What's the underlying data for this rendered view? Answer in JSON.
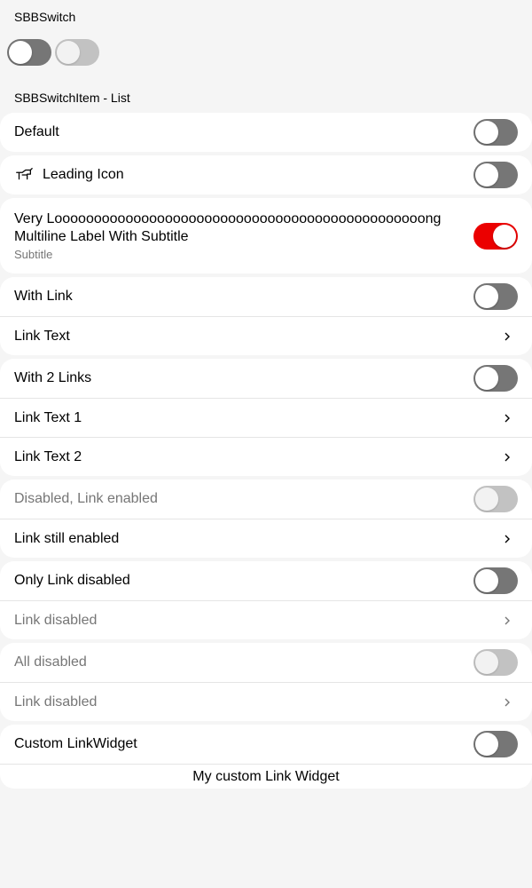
{
  "sbbswitch": {
    "title": "SBBSwitch",
    "switches": [
      {
        "state": "off",
        "enabled": true
      },
      {
        "state": "off",
        "enabled": false
      }
    ]
  },
  "list": {
    "title": "SBBSwitchItem - List",
    "items": {
      "default": {
        "label": "Default",
        "switch": "off"
      },
      "leading_icon": {
        "label": "Leading Icon",
        "icon": "train-icon",
        "switch": "off"
      },
      "multiline": {
        "label_line1": "Very Looooooooooooooooooooooooooooooooooooooooooooooong",
        "label_line2": "Multiline Label With Subtitle",
        "subtitle": "Subtitle",
        "switch": "on"
      },
      "with_link": {
        "label": "With Link",
        "switch": "off",
        "link": "Link Text"
      },
      "with_2_links": {
        "label": "With 2 Links",
        "switch": "off",
        "link1": "Link Text 1",
        "link2": "Link Text 2"
      },
      "disabled_link_enabled": {
        "label": "Disabled, Link enabled",
        "switch": "off-disabled",
        "link": "Link still enabled"
      },
      "only_link_disabled": {
        "label": "Only Link disabled",
        "switch": "off",
        "link": "Link disabled"
      },
      "all_disabled": {
        "label": "All disabled",
        "switch": "off-disabled",
        "link": "Link disabled"
      },
      "custom_link_widget": {
        "label": "Custom LinkWidget",
        "switch": "off",
        "link": "My custom Link Widget"
      }
    }
  },
  "colors": {
    "background": "#f5f5f5",
    "card": "#ffffff",
    "switch_off": "#767676",
    "switch_on": "#eb0000",
    "switch_disabled": "#c2c2c2",
    "text_disabled": "#767676"
  }
}
